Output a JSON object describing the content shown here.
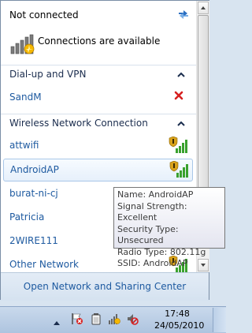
{
  "header": {
    "status_title": "Not connected",
    "connections_text": "Connections are available",
    "refresh_icon": "refresh-icon",
    "connections_icon": "network-warning-icon"
  },
  "sections": {
    "dialup": {
      "label": "Dial-up and VPN",
      "items": [
        {
          "name": "SandM",
          "icon": "disconnect-x-icon"
        }
      ]
    },
    "wireless": {
      "label": "Wireless Network Connection",
      "items": [
        {
          "name": "attwifi",
          "secured": true
        },
        {
          "name": "AndroidAP",
          "secured": true,
          "selected": true
        },
        {
          "name": "burat-ni-cj"
        },
        {
          "name": "Patricia"
        },
        {
          "name": "2WIRE111"
        },
        {
          "name": "Other Network",
          "secured": true
        }
      ]
    }
  },
  "tooltip": {
    "name": "Name: AndroidAP",
    "signal": "Signal Strength: Excellent",
    "security": "Security Type: Unsecured",
    "radio": "Radio Type: 802.11g",
    "ssid": "SSID: AndroidAP"
  },
  "footer": {
    "link": "Open Network and Sharing Center"
  },
  "taskbar": {
    "time": "17:48",
    "date": "24/05/2010",
    "tray_icons": [
      "show-hidden-icons-arrow",
      "action-center-flag-icon",
      "battery-icon",
      "network-warning-icon",
      "volume-muted-icon"
    ]
  },
  "colors": {
    "link_blue": "#1e5aa0",
    "signal_green": "#3aa12e",
    "shield_gold": "#d9a21b",
    "disconnect_red": "#d62020"
  }
}
